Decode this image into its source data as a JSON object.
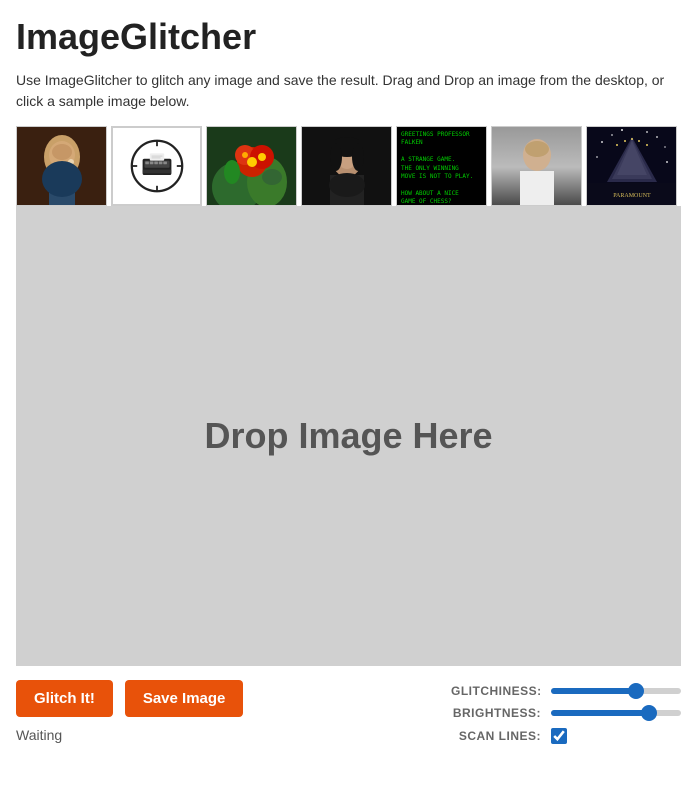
{
  "app": {
    "title": "ImageGlitcher",
    "description": "Use ImageGlitcher to glitch any image and save the result. Drag and Drop an image from the desktop, or click a sample image below."
  },
  "dropzone": {
    "text": "Drop Image Here"
  },
  "buttons": {
    "glitch": "Glitch It!",
    "save": "Save Image"
  },
  "status": {
    "text": "Waiting"
  },
  "sliders": {
    "glitchiness_label": "GLITCHINESS:",
    "brightness_label": "BRIGHTNESS:",
    "scanlines_label": "SCAN LINES:"
  },
  "samples": [
    {
      "id": 1,
      "alt": "Girl with a Pearl Earring"
    },
    {
      "id": 2,
      "alt": "Typewriter logo"
    },
    {
      "id": 3,
      "alt": "Flowers"
    },
    {
      "id": 4,
      "alt": "Portrait woman"
    },
    {
      "id": 5,
      "alt": "War Games text"
    },
    {
      "id": 6,
      "alt": "White shirt portrait"
    },
    {
      "id": 7,
      "alt": "Paramount mountain"
    }
  ]
}
